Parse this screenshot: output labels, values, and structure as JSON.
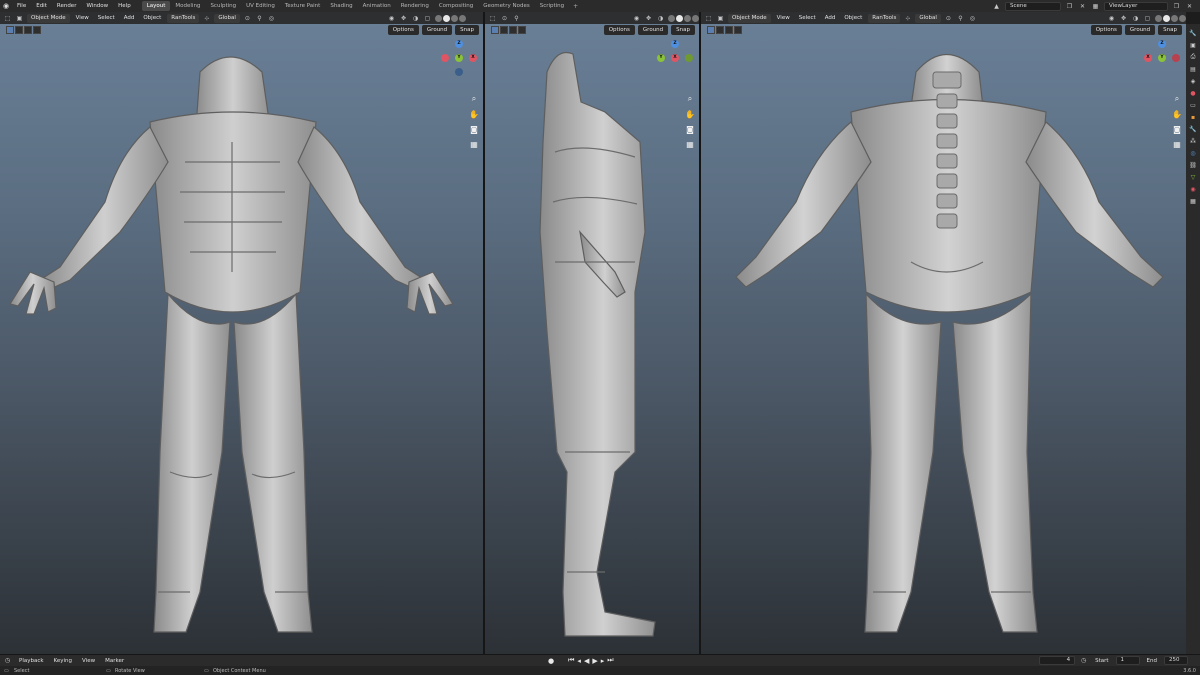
{
  "menubar": {
    "menus": [
      "File",
      "Edit",
      "Render",
      "Window",
      "Help"
    ],
    "workspaces": [
      "Layout",
      "Modeling",
      "Sculpting",
      "UV Editing",
      "Texture Paint",
      "Shading",
      "Animation",
      "Rendering",
      "Compositing",
      "Geometry Nodes",
      "Scripting"
    ],
    "active_workspace": "Layout",
    "scene": "Scene",
    "view_layer": "ViewLayer"
  },
  "viewport_header": {
    "mode": "Object Mode",
    "menus": [
      "View",
      "Select",
      "Add",
      "Object",
      "RanTools"
    ],
    "orientation": "Global"
  },
  "overlays": {
    "options_label": "Options",
    "ground_label": "Ground",
    "snap_label": "Snap"
  },
  "gizmo_axes": {
    "left": [
      "Z",
      "X",
      "Y"
    ],
    "middle": [
      "Z",
      "Y",
      "X"
    ],
    "right": [
      "Z",
      "X",
      "Y"
    ]
  },
  "timeline": {
    "playback": "Playback",
    "keying": "Keying",
    "view": "View",
    "marker": "Marker",
    "current_frame": "4",
    "start_label": "Start",
    "start": "1",
    "end_label": "End",
    "end": "250"
  },
  "statusbar": {
    "select": "Select",
    "rotate": "Rotate View",
    "context": "Object Context Menu",
    "version": "3.6.0"
  },
  "colors": {
    "accent": "#5a7fb0",
    "x_axis": "#e05563",
    "y_axis": "#8ac23a",
    "z_axis": "#4f8fe0"
  }
}
